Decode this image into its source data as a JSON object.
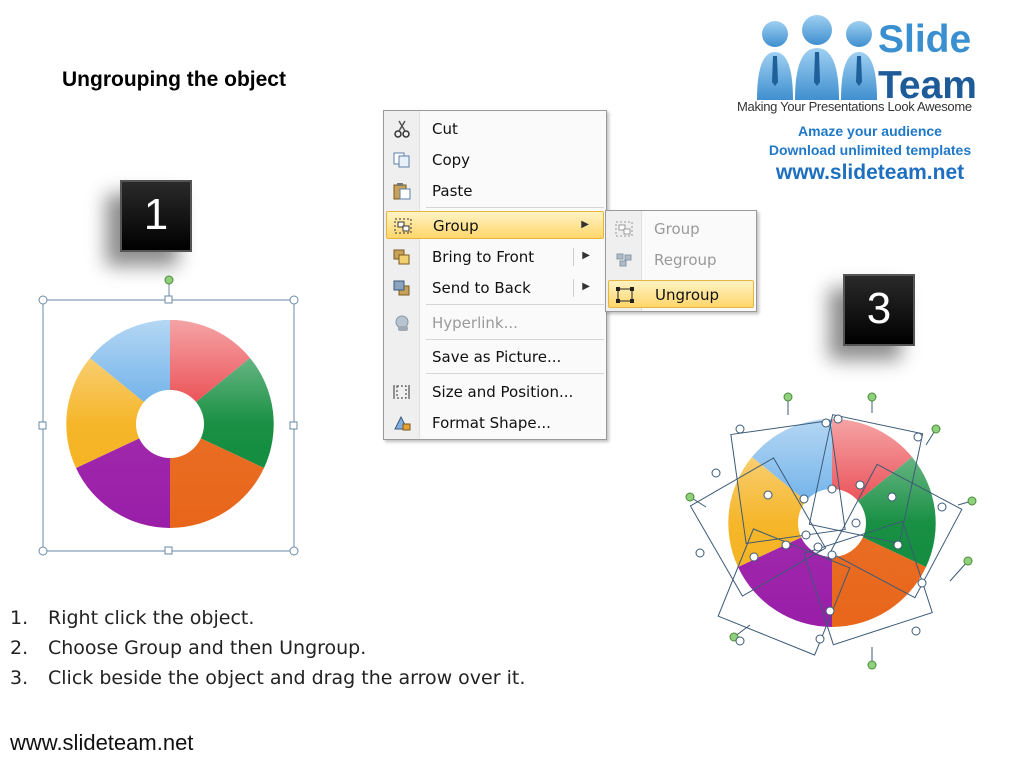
{
  "slide": {
    "title": "Ungrouping the object",
    "footer_url": "www.slideteam.net"
  },
  "logo": {
    "word1": "Slide",
    "word2": "Team",
    "tagline": "Making Your Presentations Look Awesome",
    "line1": "Amaze your audience",
    "line2": "Download unlimited templates",
    "url": "www.slideteam.net"
  },
  "badges": {
    "step1": "1",
    "step3": "3"
  },
  "context_menu": {
    "items": [
      {
        "label": "Cut",
        "icon": "scissors-icon",
        "enabled": true
      },
      {
        "label": "Copy",
        "icon": "copy-icon",
        "enabled": true
      },
      {
        "label": "Paste",
        "icon": "paste-icon",
        "enabled": true
      },
      {
        "label": "Group",
        "icon": "group-icon",
        "enabled": true,
        "highlighted": true,
        "submenu": true
      },
      {
        "label": "Bring to Front",
        "icon": "bring-to-front-icon",
        "enabled": true,
        "submenu": true
      },
      {
        "label": "Send to Back",
        "icon": "send-to-back-icon",
        "enabled": true,
        "submenu": true
      },
      {
        "label": "Hyperlink...",
        "icon": "hyperlink-icon",
        "enabled": false
      },
      {
        "label": "Save as Picture...",
        "icon": "",
        "enabled": true
      },
      {
        "label": "Size and Position...",
        "icon": "size-position-icon",
        "enabled": true
      },
      {
        "label": "Format Shape...",
        "icon": "format-shape-icon",
        "enabled": true
      }
    ]
  },
  "submenu": {
    "items": [
      {
        "label": "Group",
        "icon": "group-icon",
        "enabled": false
      },
      {
        "label": "Regroup",
        "icon": "regroup-icon",
        "enabled": false
      },
      {
        "label": "Ungroup",
        "icon": "ungroup-icon",
        "enabled": true,
        "highlighted": true
      }
    ]
  },
  "instructions": [
    {
      "num": "1.",
      "text": "Right click the object."
    },
    {
      "num": "2.",
      "text": "Choose Group and then Ungroup."
    },
    {
      "num": "3.",
      "text": "Click beside the object and drag the arrow over it."
    }
  ],
  "colors": {
    "puzzle_blue": "#5aa6e6",
    "puzzle_red": "#e8343a",
    "puzzle_green": "#0d8a3a",
    "puzzle_orange": "#e8661a",
    "puzzle_purple": "#9a1ea8",
    "puzzle_yellow": "#f5b21e",
    "menu_highlight": "#ffd66b",
    "logo_blue": "#1f78c8"
  }
}
